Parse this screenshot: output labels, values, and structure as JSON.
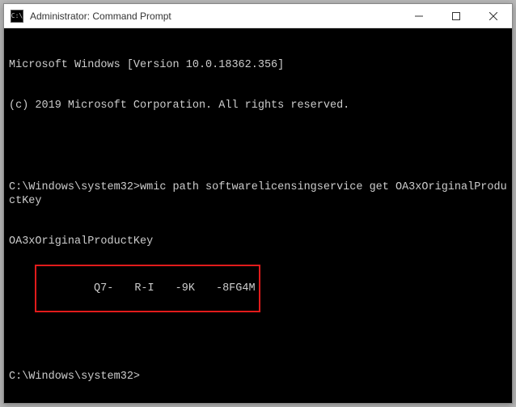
{
  "titlebar": {
    "icon_label": "CMD",
    "title": "Administrator: Command Prompt",
    "minimize": "Minimize",
    "maximize": "Maximize",
    "close": "Close"
  },
  "terminal": {
    "header_line1": "Microsoft Windows [Version 10.0.18362.356]",
    "header_line2": "(c) 2019 Microsoft Corporation. All rights reserved.",
    "prompt1_path": "C:\\Windows\\system32>",
    "command1": "wmic path softwarelicensingservice get OA3xOriginalProductKey",
    "output_header": "OA3xOriginalProductKey",
    "product_key_visible": {
      "seg1_visible": "Q7",
      "seg2_visible": "R-I",
      "seg3_visible": "9K",
      "seg4_visible": "8FG4M"
    },
    "prompt2_path": "C:\\Windows\\system32>"
  }
}
